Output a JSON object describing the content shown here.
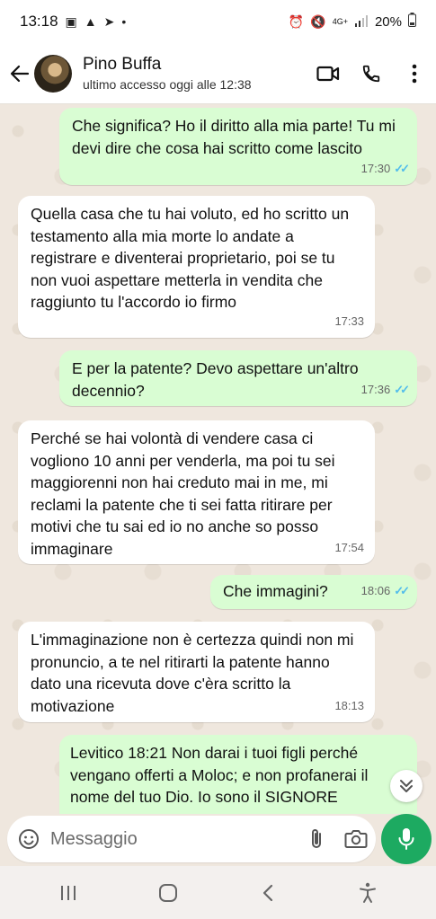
{
  "status_bar": {
    "time": "13:18",
    "network": "4G+",
    "battery": "20%"
  },
  "header": {
    "contact_name": "Pino Buffa",
    "last_seen": "ultimo accesso oggi alle 12:38"
  },
  "messages": [
    {
      "direction": "out",
      "text": "Che significa? Ho il diritto alla mia parte! Tu mi devi dire che cosa hai scritto come lascito",
      "time": "17:30",
      "read": true
    },
    {
      "direction": "in",
      "text": "Quella casa che tu hai voluto, ed ho scritto un testamento alla mia morte lo andate a registrare e diventerai proprietario, poi se tu non vuoi aspettare metterla in vendita che raggiunto tu l'accordo io firmo",
      "time": "17:33"
    },
    {
      "direction": "out",
      "text": "E per la patente? Devo aspettare un'altro decennio?",
      "time": "17:36",
      "read": true
    },
    {
      "direction": "in",
      "text": "Perché se hai volontà di vendere casa ci vogliono 10 anni per venderla, ma poi tu sei maggiorenni non hai creduto mai in me, mi reclami la  patente che ti sei fatta ritirare per motivi che tu sai ed io no anche so posso immaginare",
      "time": "17:54"
    },
    {
      "direction": "out",
      "text": "Che immagini?",
      "time": "18:06",
      "read": true
    },
    {
      "direction": "in",
      "text": "L'immaginazione non è certezza quindi non mi pronuncio, a te nel ritirarti la patente hanno dato una ricevuta dove c'èra scritto la motivazione",
      "time": "18:13"
    },
    {
      "direction": "out",
      "text": "Levitico 18:21  Non darai i tuoi figli perché vengano offerti a Moloc; e non profanerai il nome del tuo Dio. Io sono il SIGNORE",
      "time": ""
    }
  ],
  "composer": {
    "placeholder": "Messaggio"
  },
  "icons": {
    "back": "back-arrow-icon",
    "video": "video-call-icon",
    "call": "phone-icon",
    "menu": "more-vert-icon",
    "emoji": "emoji-icon",
    "attach": "paperclip-icon",
    "camera": "camera-icon",
    "mic": "mic-icon",
    "scroll": "double-chevron-down-icon"
  },
  "colors": {
    "outgoing_bubble": "#d9fdd3",
    "incoming_bubble": "#ffffff",
    "read_ticks": "#53bdeb",
    "mic_button": "#1daa61",
    "chat_background": "#efe7de"
  }
}
